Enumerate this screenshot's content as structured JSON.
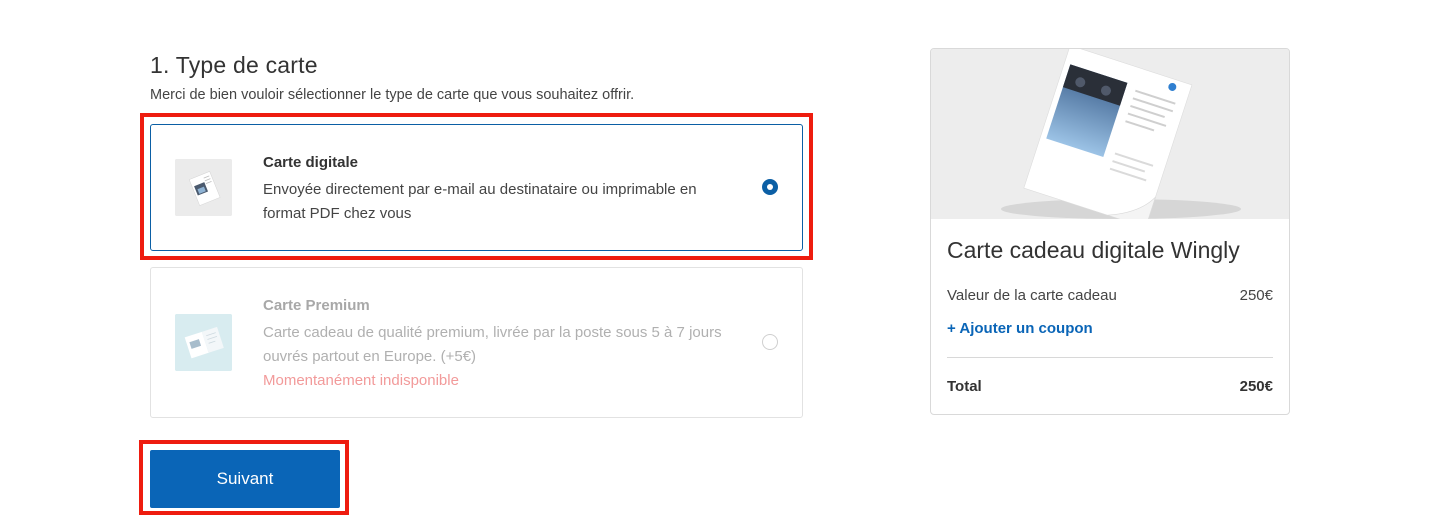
{
  "section": {
    "title": "1. Type de carte",
    "subtitle": "Merci de bien vouloir sélectionner le type de carte que vous souhaitez offrir."
  },
  "options": [
    {
      "title": "Carte digitale",
      "description": "Envoyée directement par e-mail au destinataire ou imprimable en format PDF chez vous",
      "selected": true,
      "icon": "digital-card-thumbnail"
    },
    {
      "title": "Carte Premium",
      "description": "Carte cadeau de qualité premium, livrée par la poste sous 5 à 7 jours ouvrés partout en Europe. (+5€)",
      "status": "Momentanément indisponible",
      "selected": false,
      "icon": "premium-card-thumbnail"
    }
  ],
  "next_button": {
    "label": "Suivant"
  },
  "summary": {
    "title": "Carte cadeau digitale Wingly",
    "value_label": "Valeur de la carte cadeau",
    "value_amount": "250€",
    "coupon_link": "+ Ajouter un coupon",
    "total_label": "Total",
    "total_amount": "250€"
  },
  "colors": {
    "accent": "#0a65b7",
    "highlight": "#ee1c0f",
    "unavailable": "#f29a9a"
  }
}
